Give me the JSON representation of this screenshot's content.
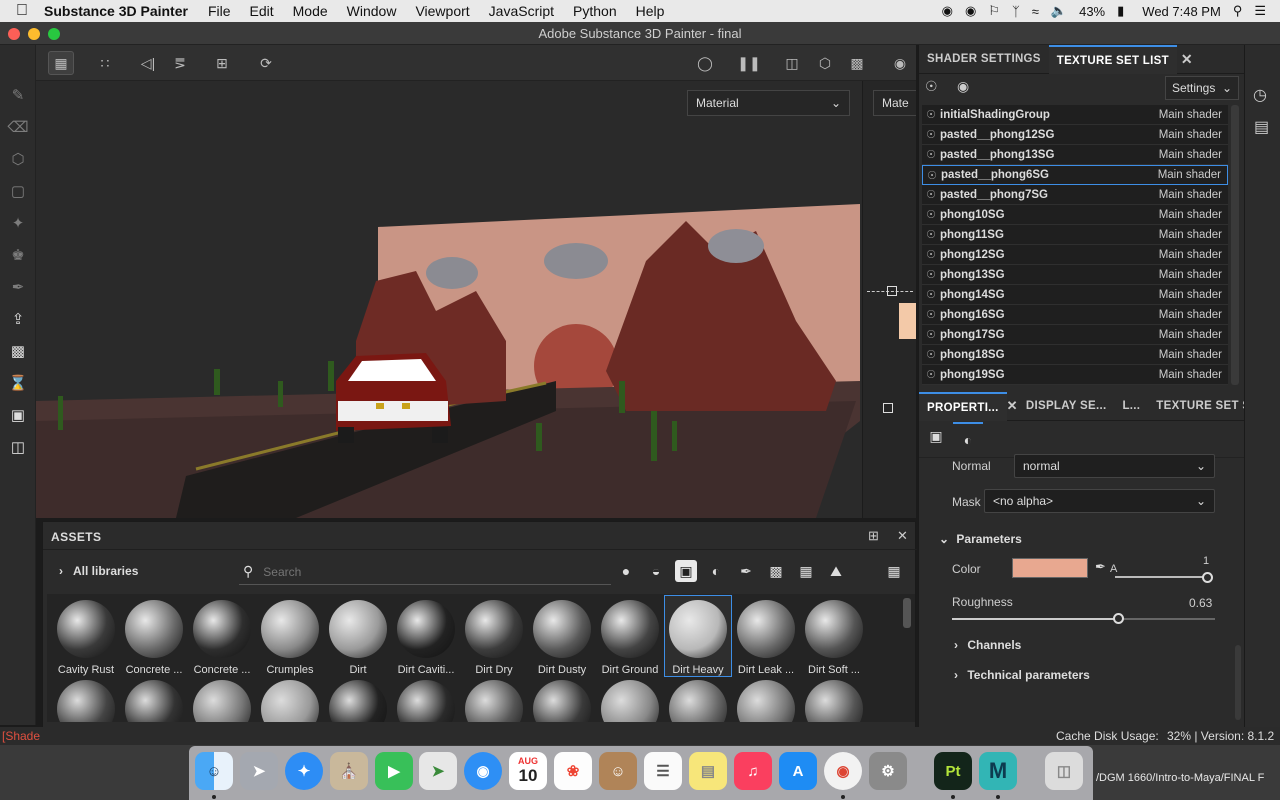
{
  "menubar": {
    "app_name": "Substance 3D Painter",
    "items": [
      "File",
      "Edit",
      "Mode",
      "Window",
      "Viewport",
      "JavaScript",
      "Python",
      "Help"
    ],
    "battery": "43%",
    "clock": "Wed 7:48 PM"
  },
  "window": {
    "title": "Adobe Substance 3D Painter - final"
  },
  "viewport": {
    "mode_dropdown": "Material",
    "mode_dropdown_2": "Mate"
  },
  "texture_set_panel": {
    "tabs": [
      "SHADER SETTINGS",
      "TEXTURE SET LIST"
    ],
    "settings_label": "Settings",
    "rows": [
      {
        "name": "initialShadingGroup",
        "shader": "Main shader"
      },
      {
        "name": "pasted__phong12SG",
        "shader": "Main shader"
      },
      {
        "name": "pasted__phong13SG",
        "shader": "Main shader"
      },
      {
        "name": "pasted__phong6SG",
        "shader": "Main shader"
      },
      {
        "name": "pasted__phong7SG",
        "shader": "Main shader"
      },
      {
        "name": "phong10SG",
        "shader": "Main shader"
      },
      {
        "name": "phong11SG",
        "shader": "Main shader"
      },
      {
        "name": "phong12SG",
        "shader": "Main shader"
      },
      {
        "name": "phong13SG",
        "shader": "Main shader"
      },
      {
        "name": "phong14SG",
        "shader": "Main shader"
      },
      {
        "name": "phong16SG",
        "shader": "Main shader"
      },
      {
        "name": "phong17SG",
        "shader": "Main shader"
      },
      {
        "name": "phong18SG",
        "shader": "Main shader"
      },
      {
        "name": "phong19SG",
        "shader": "Main shader"
      }
    ],
    "selected_index": 3
  },
  "properties_panel": {
    "tabs": [
      "PROPERTI...",
      "DISPLAY SE...",
      "L...",
      "TEXTURE SET S..."
    ],
    "blend_label": "Normal",
    "blend_value": "normal",
    "mask_label": "Mask",
    "mask_value": "<no alpha>",
    "parameters_label": "Parameters",
    "color_label": "Color",
    "color_value": "#e8a890",
    "alpha_label": "A",
    "alpha_value": "1",
    "roughness_label": "Roughness",
    "roughness_value": "0.63",
    "channels_label": "Channels",
    "technical_label": "Technical parameters"
  },
  "assets": {
    "title": "ASSETS",
    "library_label": "All libraries",
    "search_placeholder": "Search",
    "materials_row1": [
      {
        "name": "Cavity Rust",
        "tone": "#3a3a3a"
      },
      {
        "name": "Concrete ...",
        "tone": "#6a6a6a"
      },
      {
        "name": "Concrete ...",
        "tone": "#2e2e2e"
      },
      {
        "name": "Crumples",
        "tone": "#8a8a8a"
      },
      {
        "name": "Dirt",
        "tone": "#9a9a9a"
      },
      {
        "name": "Dirt Caviti...",
        "tone": "#222222"
      },
      {
        "name": "Dirt Dry",
        "tone": "#3d3d3d"
      },
      {
        "name": "Dirt Dusty",
        "tone": "#5a5a5a"
      },
      {
        "name": "Dirt Ground",
        "tone": "#444444"
      },
      {
        "name": "Dirt Heavy",
        "tone": "#b8b8b8"
      },
      {
        "name": "Dirt Leak ...",
        "tone": "#6a6a6a"
      },
      {
        "name": "Dirt Soft ...",
        "tone": "#555555"
      }
    ],
    "materials_row2_tones": [
      "#444",
      "#333",
      "#777",
      "#999",
      "#222",
      "#2a2a2a",
      "#555",
      "#3a3a3a",
      "#888",
      "#666",
      "#777",
      "#555"
    ],
    "selected_index": 9
  },
  "statusbar": {
    "left_text": "[Shade",
    "cache_label": "Cache Disk Usage:",
    "cache_value": "32% | Version: 8.1.2",
    "path_text": "/DGM 1660/Intro-to-Maya/FINAL F"
  },
  "dock": {
    "calendar_month": "AUG",
    "calendar_day": "10",
    "painter_label": "Pt",
    "maya_label": "M"
  }
}
